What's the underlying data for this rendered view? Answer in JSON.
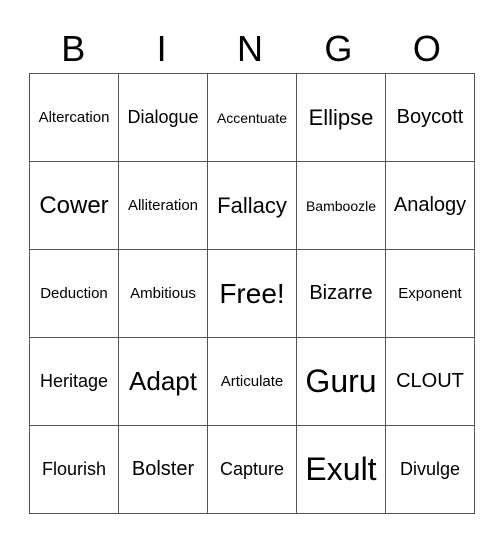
{
  "header": [
    "B",
    "I",
    "N",
    "G",
    "O"
  ],
  "rows": [
    [
      {
        "t": "Altercation",
        "s": "s15"
      },
      {
        "t": "Dialogue",
        "s": "s18"
      },
      {
        "t": "Accentuate",
        "s": "s14"
      },
      {
        "t": "Ellipse",
        "s": "s22"
      },
      {
        "t": "Boycott",
        "s": "s20"
      }
    ],
    [
      {
        "t": "Cower",
        "s": "s24"
      },
      {
        "t": "Alliteration",
        "s": "s15"
      },
      {
        "t": "Fallacy",
        "s": "s22"
      },
      {
        "t": "Bamboozle",
        "s": "s14"
      },
      {
        "t": "Analogy",
        "s": "s20"
      }
    ],
    [
      {
        "t": "Deduction",
        "s": "s15"
      },
      {
        "t": "Ambitious",
        "s": "s15"
      },
      {
        "t": "Free!",
        "s": "s28"
      },
      {
        "t": "Bizarre",
        "s": "s20"
      },
      {
        "t": "Exponent",
        "s": "s15"
      }
    ],
    [
      {
        "t": "Heritage",
        "s": "s18"
      },
      {
        "t": "Adapt",
        "s": "s26"
      },
      {
        "t": "Articulate",
        "s": "s15"
      },
      {
        "t": "Guru",
        "s": "s32"
      },
      {
        "t": "CLOUT",
        "s": "s20"
      }
    ],
    [
      {
        "t": "Flourish",
        "s": "s18"
      },
      {
        "t": "Bolster",
        "s": "s20"
      },
      {
        "t": "Capture",
        "s": "s18"
      },
      {
        "t": "Exult",
        "s": "s32"
      },
      {
        "t": "Divulge",
        "s": "s18"
      }
    ]
  ]
}
